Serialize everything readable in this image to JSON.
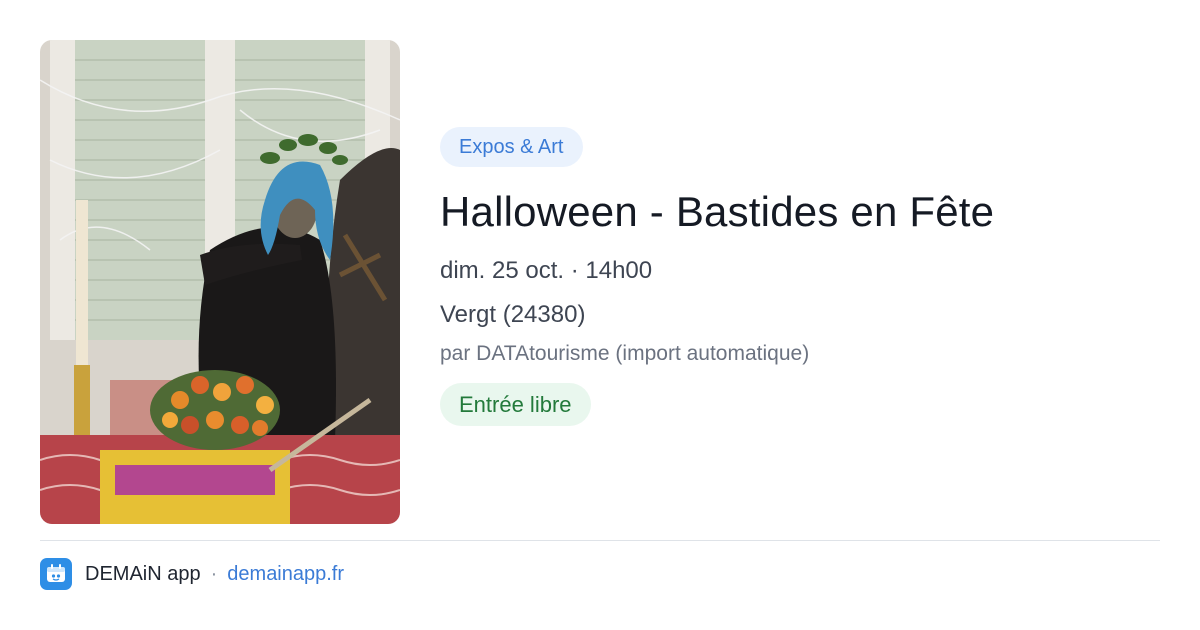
{
  "event": {
    "category": "Expos & Art",
    "title": "Halloween - Bastides en Fête",
    "datetime": "dim. 25 oct. · 14h00",
    "location": "Vergt (24380)",
    "organizer": "par DATAtourisme (import automatique)",
    "price": "Entrée libre"
  },
  "image": {
    "description_icon": "event-photo"
  },
  "footer": {
    "app_name": "DEMAiN app",
    "separator": "·",
    "url": "demainapp.fr",
    "icon": "demain-app-icon"
  },
  "colors": {
    "category_bg": "#eaf2fd",
    "category_text": "#3b7bd6",
    "price_bg": "#e9f7ee",
    "price_text": "#237a3b",
    "link": "#3b7bd6",
    "app_icon_bg": "#2e8ee6"
  }
}
